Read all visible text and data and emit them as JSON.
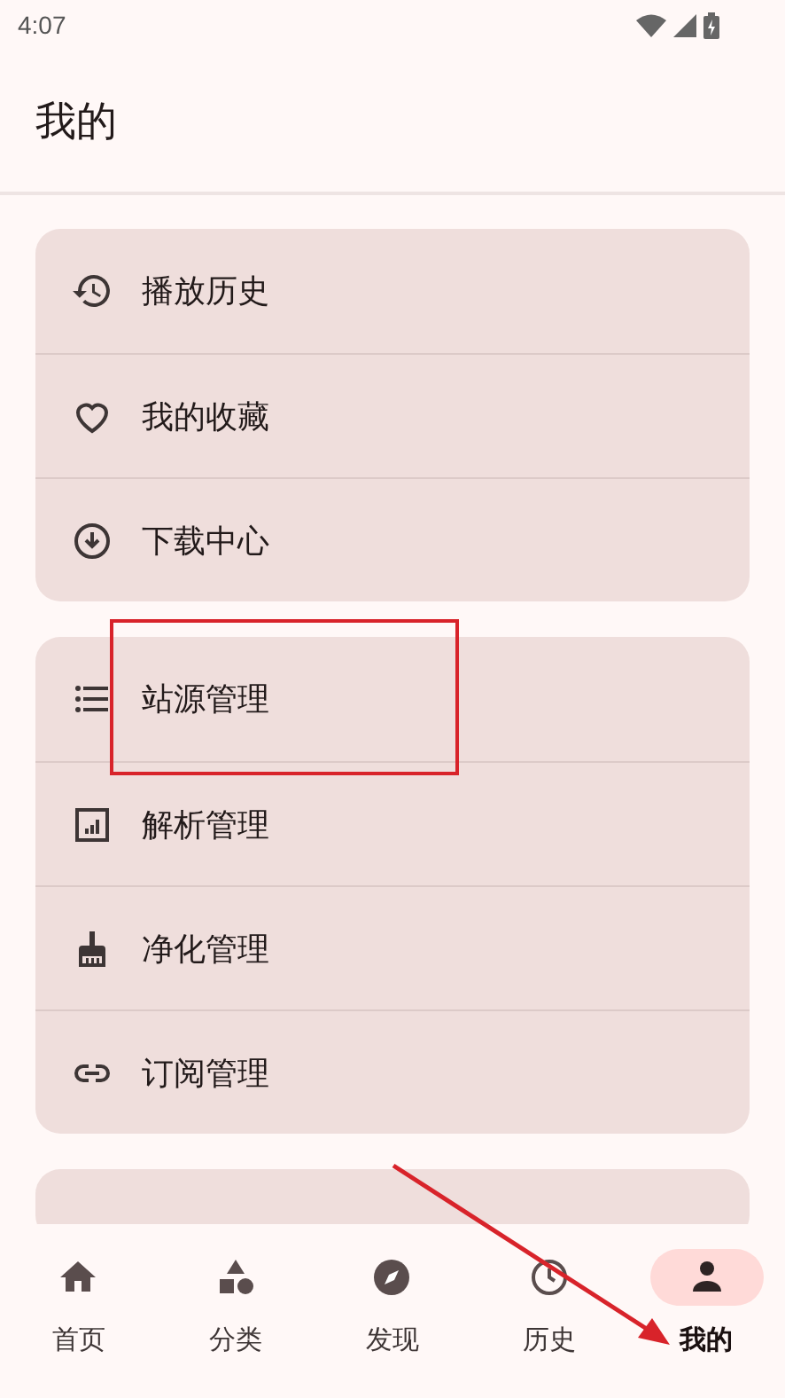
{
  "status_bar": {
    "time": "4:07"
  },
  "header": {
    "title": "我的"
  },
  "groups": [
    {
      "items": [
        {
          "label": "播放历史"
        },
        {
          "label": "我的收藏"
        },
        {
          "label": "下载中心"
        }
      ]
    },
    {
      "items": [
        {
          "label": "站源管理"
        },
        {
          "label": "解析管理"
        },
        {
          "label": "净化管理"
        },
        {
          "label": "订阅管理"
        }
      ]
    }
  ],
  "bottom_nav": [
    {
      "label": "首页",
      "selected": false
    },
    {
      "label": "分类",
      "selected": false
    },
    {
      "label": "发现",
      "selected": false
    },
    {
      "label": "历史",
      "selected": false
    },
    {
      "label": "我的",
      "selected": true
    }
  ]
}
